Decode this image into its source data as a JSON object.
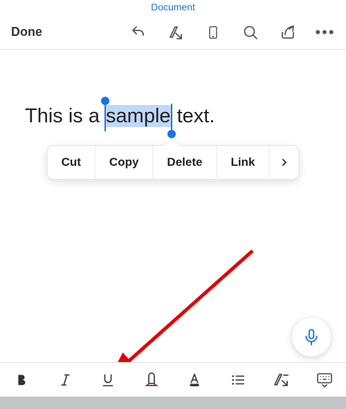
{
  "header": {
    "title": "Document",
    "done_label": "Done"
  },
  "editor": {
    "before": "This is a ",
    "selected": "sample",
    "after": " text."
  },
  "context_menu": {
    "items": [
      "Cut",
      "Copy",
      "Delete",
      "Link"
    ]
  }
}
